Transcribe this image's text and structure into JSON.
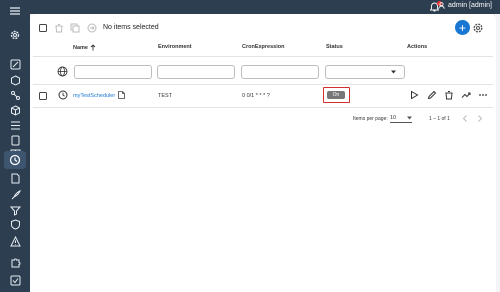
{
  "header": {
    "user_label": "admin [admin]",
    "notification_count_visible": true
  },
  "sidebar": {
    "items": [
      {
        "icon": "menu-icon"
      },
      {
        "icon": "settings-icon"
      },
      {
        "icon": "edit-icon"
      },
      {
        "icon": "cube-outline-icon"
      },
      {
        "icon": "transform-icon"
      },
      {
        "icon": "cube-icon"
      },
      {
        "icon": "list-icon"
      },
      {
        "icon": "document-icon"
      },
      {
        "icon": "book-icon"
      },
      {
        "icon": "clock-icon",
        "active": true
      },
      {
        "icon": "file-icon"
      },
      {
        "icon": "rocket-icon"
      },
      {
        "icon": "filter-icon"
      },
      {
        "icon": "shield-icon"
      },
      {
        "icon": "warning-icon"
      },
      {
        "icon": "puzzle-icon"
      },
      {
        "icon": "checklist-icon"
      }
    ]
  },
  "toolbar": {
    "selection_text": "No items selected"
  },
  "table": {
    "columns": [
      "Name",
      "Environment",
      "CronExpression",
      "Status",
      "Actions"
    ],
    "rows": [
      {
        "name": "myTestScheduler",
        "environment": "TEST",
        "cron": "0 0/1 * * * ?",
        "status": "On"
      }
    ]
  },
  "pagination": {
    "items_per_page_label": "Items per page:",
    "items_per_page_value": "10",
    "range_text": "1 – 1 of 1"
  },
  "colors": {
    "sidebar_bg": "#2c3e50",
    "accent": "#1976d2",
    "highlight_border": "#d32f2f"
  }
}
